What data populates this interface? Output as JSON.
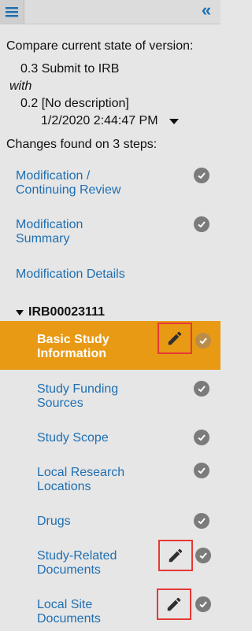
{
  "header": {
    "menu_icon": "hamburger-icon",
    "collapse_icon": "double-chevron-left-icon"
  },
  "compare": {
    "title": "Compare current state of version:",
    "current_version": "0.3 Submit to IRB",
    "with_label": "with",
    "other_version": "0.2 [No description]",
    "other_version_date": "1/2/2020 2:44:47 PM",
    "changes_summary": "Changes found on 3 steps:"
  },
  "steps": [
    {
      "label1": "Modification /",
      "label2": "Continuing Review"
    },
    {
      "label1": "Modification",
      "label2": "Summary"
    },
    {
      "label1": "Modification Details",
      "label2": ""
    }
  ],
  "group": {
    "name": "IRB00023111"
  },
  "substeps": [
    {
      "label1": "Basic Study",
      "label2": "Information",
      "active": true,
      "edited": true
    },
    {
      "label1": "Study Funding",
      "label2": "Sources",
      "active": false,
      "edited": false
    },
    {
      "label1": "Study Scope",
      "label2": "",
      "active": false,
      "edited": false
    },
    {
      "label1": "Local Research",
      "label2": "Locations",
      "active": false,
      "edited": false
    },
    {
      "label1": "Drugs",
      "label2": "",
      "active": false,
      "edited": false
    },
    {
      "label1": "Study-Related",
      "label2": "Documents",
      "active": false,
      "edited": true
    },
    {
      "label1": "Local Site",
      "label2": "Documents",
      "active": false,
      "edited": true
    }
  ],
  "colors": {
    "link": "#1f6fb2",
    "active_bg": "#e89a14",
    "check_bg": "#7b7b7b",
    "highlight_border": "#e53935"
  }
}
